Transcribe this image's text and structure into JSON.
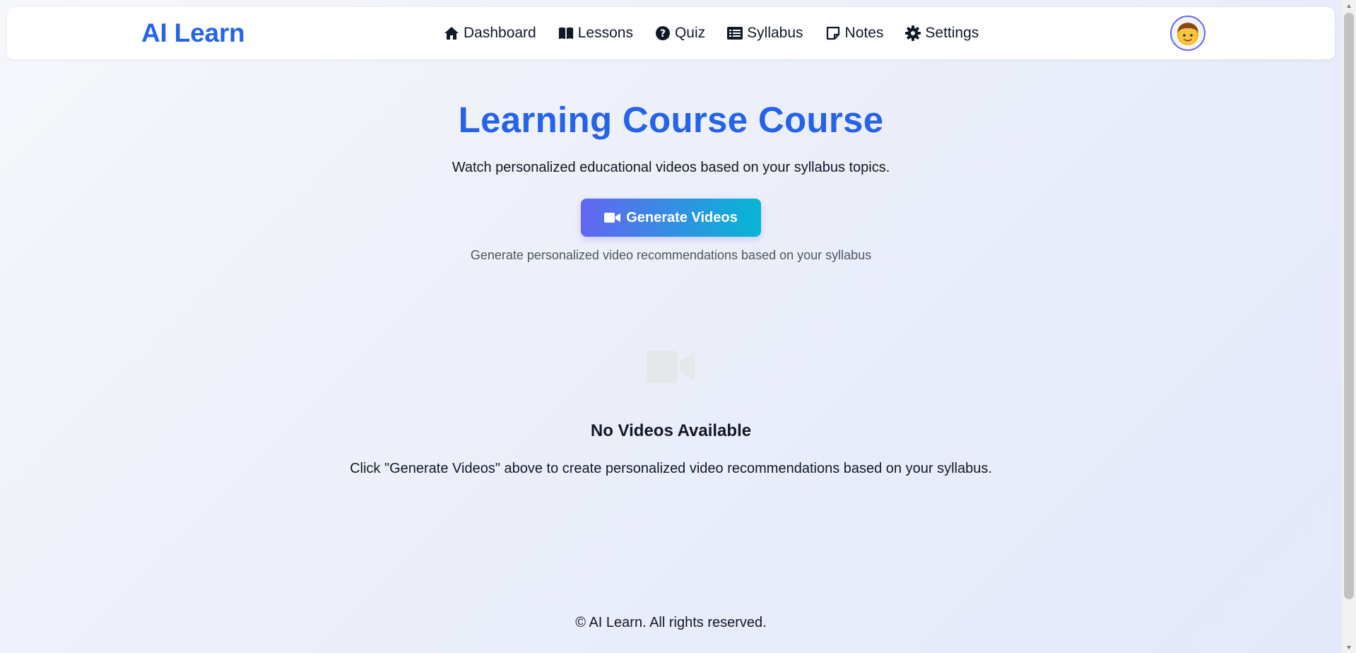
{
  "brand": "AI Learn",
  "nav": {
    "items": [
      {
        "label": "Dashboard",
        "icon": "home-icon"
      },
      {
        "label": "Lessons",
        "icon": "book-icon"
      },
      {
        "label": "Quiz",
        "icon": "question-circle-icon"
      },
      {
        "label": "Syllabus",
        "icon": "list-icon"
      },
      {
        "label": "Notes",
        "icon": "note-icon"
      },
      {
        "label": "Settings",
        "icon": "gear-icon"
      }
    ]
  },
  "user": {
    "avatar": "boy-emoji-avatar"
  },
  "hero": {
    "title": "Learning Course Course",
    "subtitle": "Watch personalized educational videos based on your syllabus topics.",
    "button_label": "Generate Videos",
    "button_icon": "video-camera-icon",
    "hint": "Generate personalized video recommendations based on your syllabus"
  },
  "empty_state": {
    "icon": "video-camera-icon",
    "title": "No Videos Available",
    "text": "Click \"Generate Videos\" above to create personalized video recommendations based on your syllabus."
  },
  "footer": {
    "text": "© AI Learn. All rights reserved."
  },
  "colors": {
    "accent": "#2563eb",
    "button_gradient_start": "#6366f1",
    "button_gradient_end": "#06b6d4",
    "empty_icon": "#e5e7eb"
  }
}
